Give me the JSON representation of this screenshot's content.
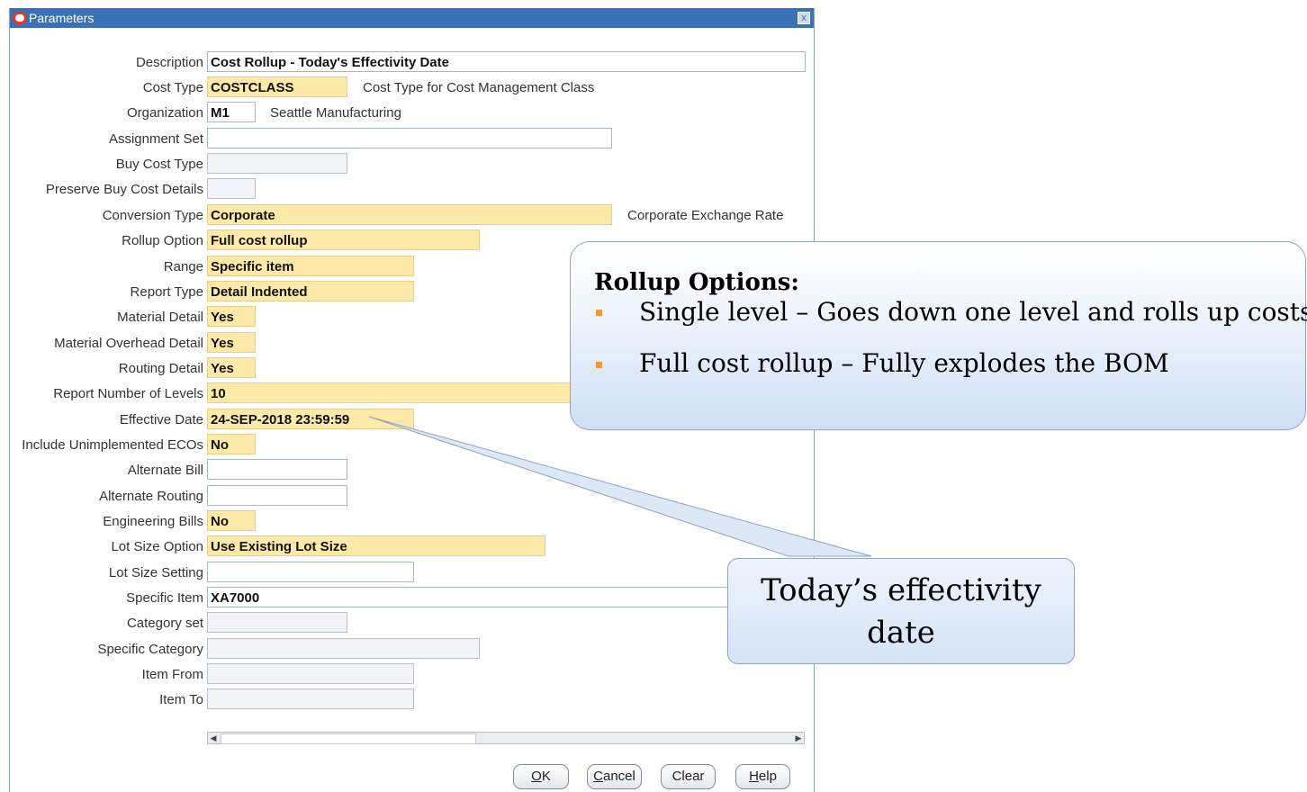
{
  "window": {
    "title": "Parameters",
    "close_symbol": "x"
  },
  "fields": [
    {
      "label": "Description",
      "value": "Cost Rollup - Today's Effectivity Date",
      "style": "opt",
      "desc": ""
    },
    {
      "label": "Cost Type",
      "value": "COSTCLASS",
      "style": "req",
      "desc": "Cost Type for Cost Management Class"
    },
    {
      "label": "Organization",
      "value": "M1",
      "style": "opt",
      "desc": "Seattle Manufacturing"
    },
    {
      "label": "Assignment Set",
      "value": "",
      "style": "opt",
      "desc": ""
    },
    {
      "label": "Buy Cost Type",
      "value": "",
      "style": "ro",
      "desc": ""
    },
    {
      "label": "Preserve Buy Cost Details",
      "value": "",
      "style": "ro",
      "desc": ""
    },
    {
      "label": "Conversion Type",
      "value": "Corporate",
      "style": "req",
      "desc": "Corporate Exchange Rate"
    },
    {
      "label": "Rollup Option",
      "value": "Full cost rollup",
      "style": "req",
      "desc": ""
    },
    {
      "label": "Range",
      "value": "Specific item",
      "style": "req",
      "desc": ""
    },
    {
      "label": "Report Type",
      "value": "Detail Indented",
      "style": "req",
      "desc": ""
    },
    {
      "label": "Material Detail",
      "value": "Yes",
      "style": "req",
      "desc": ""
    },
    {
      "label": "Material Overhead Detail",
      "value": "Yes",
      "style": "req",
      "desc": ""
    },
    {
      "label": "Routing Detail",
      "value": "Yes",
      "style": "req",
      "desc": ""
    },
    {
      "label": "Report Number of Levels",
      "value": "10",
      "style": "req",
      "desc": ""
    },
    {
      "label": "Effective Date",
      "value": "24-SEP-2018 23:59:59",
      "style": "req",
      "desc": ""
    },
    {
      "label": "Include Unimplemented ECOs",
      "value": "No",
      "style": "req",
      "desc": ""
    },
    {
      "label": "Alternate Bill",
      "value": "",
      "style": "opt",
      "desc": ""
    },
    {
      "label": "Alternate Routing",
      "value": "",
      "style": "opt",
      "desc": ""
    },
    {
      "label": "Engineering Bills",
      "value": "No",
      "style": "req",
      "desc": ""
    },
    {
      "label": "Lot Size Option",
      "value": "Use Existing Lot Size",
      "style": "req",
      "desc": ""
    },
    {
      "label": "Lot Size Setting",
      "value": "",
      "style": "opt",
      "desc": ""
    },
    {
      "label": "Specific Item",
      "value": "XA7000",
      "style": "opt",
      "desc": ""
    },
    {
      "label": "Category set",
      "value": "",
      "style": "ro",
      "desc": ""
    },
    {
      "label": "Specific Category",
      "value": "",
      "style": "ro",
      "desc": ""
    },
    {
      "label": "Item From",
      "value": "",
      "style": "ro",
      "desc": ""
    },
    {
      "label": "Item To",
      "value": "",
      "style": "ro",
      "desc": ""
    }
  ],
  "buttons": {
    "ok": {
      "mnemonic": "O",
      "rest": "K"
    },
    "cancel": {
      "mnemonic": "C",
      "rest": "ancel"
    },
    "clear": {
      "mnemonic": "",
      "rest": "Clear"
    },
    "help": {
      "mnemonic": "H",
      "rest": "elp"
    }
  },
  "callout_rollup": {
    "heading": "Rollup Options:",
    "bullets": [
      "Single level – Goes down one level and rolls up costs",
      "Full cost rollup – Fully explodes the BOM"
    ],
    "bullet_color": "#f0963c"
  },
  "callout_effectivity": {
    "line1": "Today’s effectivity",
    "line2": "date"
  },
  "colors": {
    "titlebar": "#3a70b4",
    "required_field": "#fde9a8"
  }
}
